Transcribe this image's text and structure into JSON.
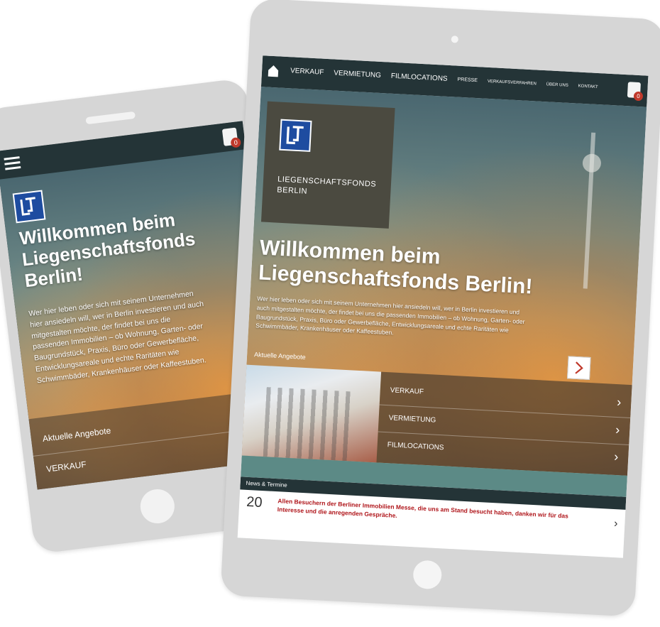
{
  "phone": {
    "hero_title_line1": "Willkommen beim",
    "hero_title_line2": "Liegenschaftsfonds",
    "hero_title_line3": "Berlin!",
    "hero_text": "Wer hier leben oder sich mit seinem Unternehmen hier ansiedeln will, wer in Berlin investieren und auch mitgestalten möchte, der findet bei uns die passenden Immobilien – ob Wohnung, Garten- oder Baugrundstück, Praxis, Büro oder Gewerbefläche, Entwicklungsareale und echte Raritäten wie Schwimmbäder, Krankenhäuser oder Kaffeestuben.",
    "offers_label": "Aktuelle Angebote",
    "verkauf_label": "VERKAUF",
    "cart_count": "0"
  },
  "tablet": {
    "nav": {
      "items": [
        "VERKAUF",
        "VERMIETUNG",
        "FILMLOCATIONS",
        "PRESSE",
        "VERKAUFSVERFAHREN",
        "ÜBER UNS",
        "KONTAKT"
      ]
    },
    "cart_count": "0",
    "logo_text_line1": "LIEGENSCHAFTSFONDS",
    "logo_text_line2": "BERLIN",
    "hero_title_line1": "Willkommen beim",
    "hero_title_line2": "Liegenschaftsfonds Berlin!",
    "hero_text": "Wer hier leben oder sich mit seinem Unternehmen hier ansiedeln will, wer in Berlin investieren und auch mitgestalten möchte, der findet bei uns die passenden Immobilien – ob Wohnung, Garten- oder Baugrundstück, Praxis, Büro oder Gewerbefläche, Entwicklungsareale und echte Raritäten wie Schwimmbäder, Krankenhäuser oder Kaffeestuben.",
    "offers_label": "Aktuelle Angebote",
    "offers": [
      "VERKAUF",
      "VERMIETUNG",
      "FILMLOCATIONS"
    ],
    "news_label": "News & Termine",
    "news_day": "20",
    "news_text": "Allen Besuchern der Berliner Immobilien Messe, die uns am Stand besucht haben, danken wir für das Interesse und die anregenden Gespräche."
  },
  "colors": {
    "navbar": "#243437",
    "device_frame": "#d6d6d6",
    "accent_red": "#c0392b",
    "logo_blue": "#1e4ca0",
    "news_red": "#b0171c",
    "teal_strip": "#5c8a86"
  }
}
